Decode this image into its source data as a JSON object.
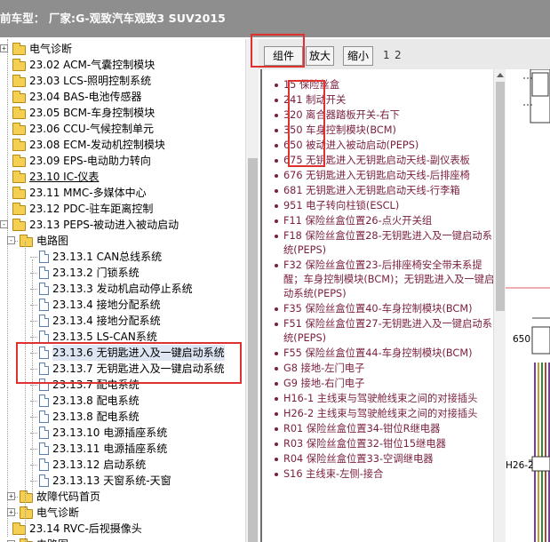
{
  "header": {
    "vehicle_label": "前车型：  厂家:G-观致汽车观致3 SUV2015"
  },
  "tree": {
    "items": [
      {
        "label": "电气诊断",
        "type": "folder",
        "level": 0,
        "expander": "+"
      },
      {
        "label": "23.02 ACM-气囊控制模块",
        "type": "folder",
        "level": 0
      },
      {
        "label": "23.03 LCS-照明控制系统",
        "type": "folder",
        "level": 0
      },
      {
        "label": "23.04 BAS-电池传感器",
        "type": "folder",
        "level": 0
      },
      {
        "label": "23.05 BCM-车身控制模块",
        "type": "folder",
        "level": 0
      },
      {
        "label": "23.06 CCU-气候控制单元",
        "type": "folder",
        "level": 0
      },
      {
        "label": "23.08 ECM-发动机控制模块",
        "type": "folder",
        "level": 0
      },
      {
        "label": "23.09 EPS-电动助力转向",
        "type": "folder",
        "level": 0
      },
      {
        "label": "23.10 IC-仪表",
        "type": "folder",
        "level": 0,
        "current": true
      },
      {
        "label": "23.11 MMC-多媒体中心",
        "type": "folder",
        "level": 0
      },
      {
        "label": "23.12 PDC-驻车距离控制",
        "type": "folder",
        "level": 0
      },
      {
        "label": "23.13 PEPS-被动进入被动启动",
        "type": "folder",
        "level": 0,
        "expander": "-"
      },
      {
        "label": "电路图",
        "type": "folder",
        "level": 1,
        "expander": "-"
      },
      {
        "label": "23.13.1 CAN总线系统",
        "type": "doc",
        "level": 2
      },
      {
        "label": "23.13.2 门锁系统",
        "type": "doc",
        "level": 2
      },
      {
        "label": "23.13.3 发动机启动停止系统",
        "type": "doc",
        "level": 2
      },
      {
        "label": "23.13.4 接地分配系统",
        "type": "doc",
        "level": 2
      },
      {
        "label": "23.13.4 接地分配系统",
        "type": "doc",
        "level": 2
      },
      {
        "label": "23.13.5 LS-CAN系统",
        "type": "doc",
        "level": 2
      },
      {
        "label": "23.13.6 无钥匙进入及一键启动系统",
        "type": "doc",
        "level": 2,
        "selected": true
      },
      {
        "label": "23.13.7 无钥匙进入及一键启动系统",
        "type": "doc",
        "level": 2
      },
      {
        "label": "23.13.7 配电系统",
        "type": "doc",
        "level": 2
      },
      {
        "label": "23.13.8 配电系统",
        "type": "doc",
        "level": 2
      },
      {
        "label": "23.13.8 配电系统",
        "type": "doc",
        "level": 2
      },
      {
        "label": "23.13.10 电源插座系统",
        "type": "doc",
        "level": 2
      },
      {
        "label": "23.13.11 电源插座系统",
        "type": "doc",
        "level": 2
      },
      {
        "label": "23.13.12 启动系统",
        "type": "doc",
        "level": 2
      },
      {
        "label": "23.13.13 天窗系统-天窗",
        "type": "doc",
        "level": 2
      },
      {
        "label": "故障代码首页",
        "type": "folder",
        "level": 1,
        "expander": "+"
      },
      {
        "label": "电气诊断",
        "type": "folder",
        "level": 1,
        "expander": "+"
      },
      {
        "label": "23.14 RVC-后视摄像头",
        "type": "folder",
        "level": 0
      },
      {
        "label": "电路图",
        "type": "folder",
        "level": 1,
        "expander": "+"
      }
    ]
  },
  "toolbar": {
    "components_label": "组件",
    "zoom_label": "放大",
    "shrink_label": "缩小",
    "pages": [
      "1",
      "2"
    ]
  },
  "components": [
    "15 保险丝盒",
    "241 制动开关",
    "320 离合器踏板开关-右下",
    "350 车身控制模块(BCM)",
    "650 被动进入被动启动(PEPS)",
    "675 无钥匙进入无钥匙启动天线-副仪表板",
    "676 无钥匙进入无钥匙启动天线-后排座椅",
    "681 无钥匙进入无钥匙启动天线-行李箱",
    "951 电子转向柱锁(ESCL)",
    "F11 保险丝盒位置26-点火开关组",
    "F18 保险丝盒位置28-无钥匙进入及一键启动系统(PEPS)",
    "F32 保险丝盒位置23-后排座椅安全带未系提醒；车身控制模块(BCM)；无钥匙进入及一键启动系统(PEPS)",
    "F35 保险丝盒位置40-车身控制模块(BCM)",
    "F51 保险丝盒位置27-无钥匙进入及一键启动系统(PEPS)",
    "F55 保险丝盒位置44-车身控制模块(BCM)",
    "G8 接地-左门电子",
    "G9 接地-右门电子",
    "H16-1 主线束与驾驶舱线束之间的对接插头",
    "H26-2 主线束与驾驶舱线束之间的对接插头",
    "R01 保险丝盒位置34-钳位R继电器",
    "R03 保险丝盒位置32-钳位15继电器",
    "R04 保险丝盒位置33-空调继电器",
    "S16 主线束-左侧-接合"
  ],
  "diagram": {
    "label_650": "650",
    "label_h26": "H26-2"
  },
  "colors": {
    "header_bg": "#8e8e8e",
    "component_text": "#7a1f3c",
    "highlight": "#e03131",
    "folder": "#f4cf52"
  }
}
